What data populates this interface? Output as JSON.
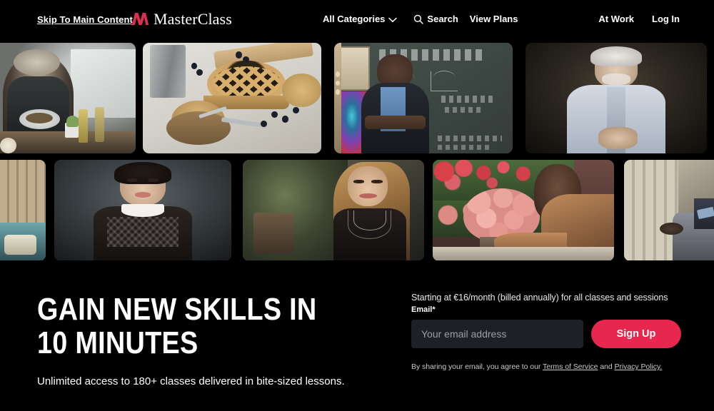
{
  "header": {
    "skip_link": "Skip To Main Content",
    "logo": {
      "text": "MasterClass",
      "mark": "masterclass-m-mark",
      "color": "#d9304f"
    },
    "nav_center": [
      {
        "label": "All Categories",
        "icon": "chevron-down-icon"
      },
      {
        "label": "Search",
        "icon": "search-icon"
      },
      {
        "label": "View Plans",
        "icon": null
      }
    ],
    "nav_right": [
      {
        "label": "At Work"
      },
      {
        "label": "Log In"
      }
    ]
  },
  "gallery": {
    "pause_button": "pause-icon",
    "row1": [
      {
        "name": "chef-portrait-kitchen",
        "alt": "Chef holding plate in kitchen"
      },
      {
        "name": "lattice-pie-baking",
        "alt": "Blueberry lattice pie with slice"
      },
      {
        "name": "astrophysicist-blackboard",
        "alt": "Scientist in front of blackboard"
      },
      {
        "name": "entrepreneur-portrait",
        "alt": "Entrepreneur in light blue shirt"
      }
    ],
    "row2": [
      {
        "name": "interior-room-partial",
        "alt": "Interior room with screen"
      },
      {
        "name": "media-producer-portrait",
        "alt": "Woman with short dark hair, collared top"
      },
      {
        "name": "singer-portrait",
        "alt": "Singer with long wavy hair"
      },
      {
        "name": "floral-arrangement",
        "alt": "Hands arranging pink roses"
      },
      {
        "name": "writer-seated-partial",
        "alt": "Seated person writing"
      }
    ]
  },
  "hero": {
    "headline": "Gain New Skills In 10 Minutes",
    "subhead": "Unlimited access to 180+ classes delivered in bite-sized lessons.",
    "price_line": "Starting at €16/month (billed annually) for all classes and sessions",
    "email_label": "Email*",
    "email_value": "",
    "email_placeholder": "Your email address",
    "signup_label": "Sign Up",
    "legal_prefix": "By sharing your email, you agree to our ",
    "legal_terms": "Terms of Service",
    "legal_middle": " and ",
    "legal_privacy": "Privacy Policy.",
    "accent_color": "#e8274e"
  }
}
